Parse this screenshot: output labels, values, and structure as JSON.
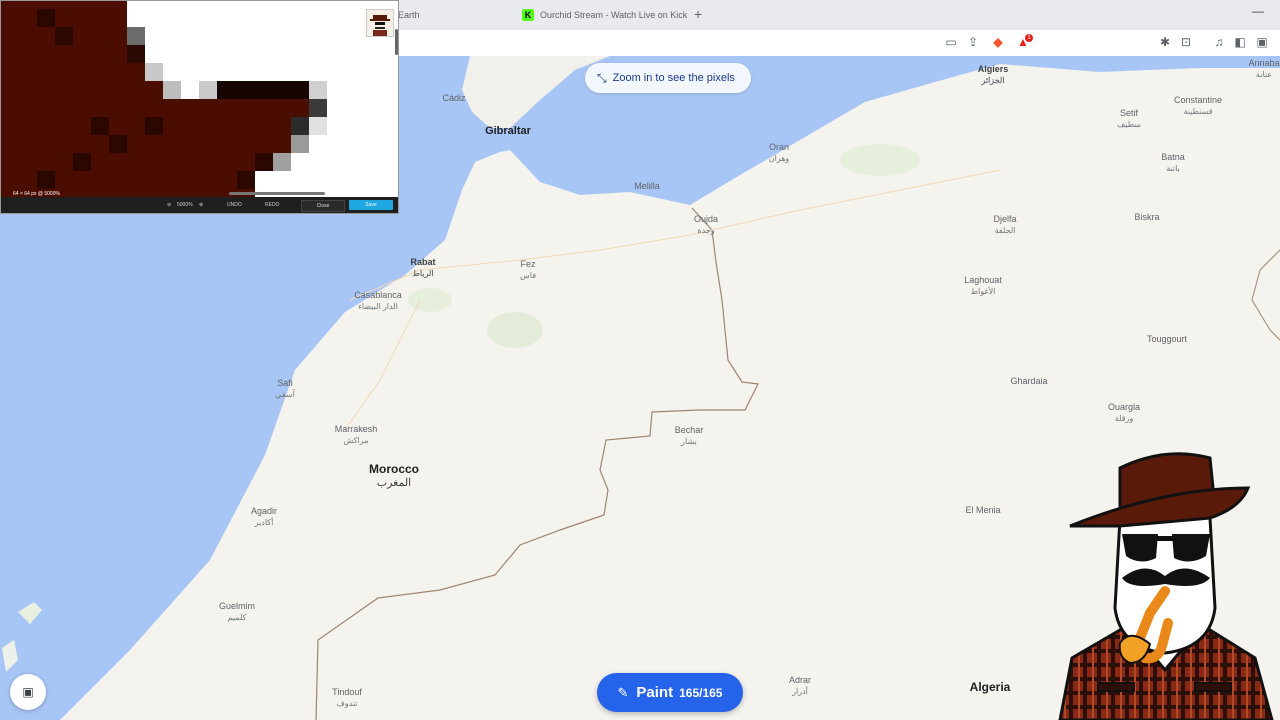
{
  "browser": {
    "tabs": [
      {
        "label": "Earth"
      },
      {
        "label": "Ourchid Stream - Watch Live on Kick"
      }
    ],
    "new_tab_symbol": "+",
    "minimize_symbol": "—",
    "rewards_badge": "1"
  },
  "map": {
    "zoom_hint": "Zoom in to see the pixels",
    "paint": {
      "label": "Paint",
      "count": "165/165"
    },
    "labels": [
      {
        "name": "Algiers",
        "arabic": "الجزائر"
      },
      {
        "name": "Annaba",
        "arabic": "عنابة"
      },
      {
        "name": "Cádiz",
        "arabic": ""
      },
      {
        "name": "Gibraltar",
        "arabic": ""
      },
      {
        "name": "Oran",
        "arabic": "وهران"
      },
      {
        "name": "Melilla",
        "arabic": ""
      },
      {
        "name": "Setif",
        "arabic": "سطيف"
      },
      {
        "name": "Constantine",
        "arabic": "قسنطينة"
      },
      {
        "name": "Batna",
        "arabic": "باتنة"
      },
      {
        "name": "Biskra",
        "arabic": ""
      },
      {
        "name": "Oujda",
        "arabic": "وجدة"
      },
      {
        "name": "Djelfa",
        "arabic": "الجلفة"
      },
      {
        "name": "Rabat",
        "arabic": "الرباط"
      },
      {
        "name": "Fez",
        "arabic": "فاس"
      },
      {
        "name": "Casablanca",
        "arabic": "الدار البيضاء"
      },
      {
        "name": "Laghouat",
        "arabic": "الأغواط"
      },
      {
        "name": "Touggourt",
        "arabic": ""
      },
      {
        "name": "Safi",
        "arabic": "آسفي"
      },
      {
        "name": "Ghardaia",
        "arabic": ""
      },
      {
        "name": "Ouargla",
        "arabic": "ورقلة"
      },
      {
        "name": "Marrakesh",
        "arabic": "مراكش"
      },
      {
        "name": "Bechar",
        "arabic": "بشار"
      },
      {
        "name": "Morocco",
        "arabic": "المغرب"
      },
      {
        "name": "Agadir",
        "arabic": "أكادير"
      },
      {
        "name": "El Menia",
        "arabic": ""
      },
      {
        "name": "Guelmim",
        "arabic": "كلميم"
      },
      {
        "name": "Tindouf",
        "arabic": "تندوف"
      },
      {
        "name": "Adrar",
        "arabic": "أدرار"
      },
      {
        "name": "Algeria",
        "arabic": ""
      }
    ]
  },
  "preview": {
    "status": "64 × 64 px @ 5000%",
    "zoom": "5000%",
    "undo": "UNDO",
    "redo": "REDO",
    "close": "Close",
    "save": "Save"
  },
  "colors": {
    "water": "#a8c6f5",
    "land": "#f5f3ee",
    "border": "#a08570",
    "paint_button": "#2563eb",
    "pixel_dark_red": "#4a0d00",
    "save_button": "#1ea7e1"
  }
}
